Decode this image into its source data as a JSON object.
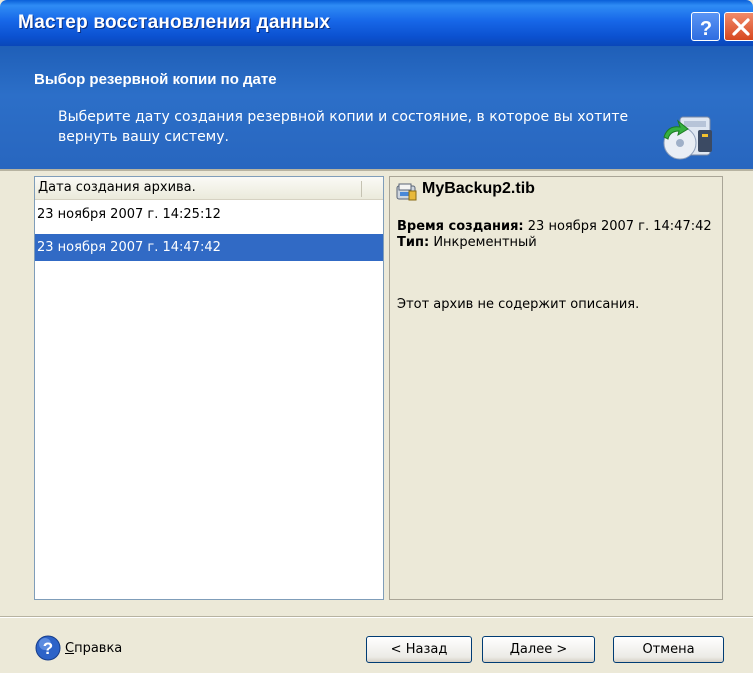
{
  "window": {
    "title": "Мастер восстановления данных",
    "help_button": "?",
    "close_button": "X"
  },
  "header": {
    "title": "Выбор резервной копии по дате",
    "description": "Выберите дату создания резервной копии и состояние, в которое вы хотите вернуть вашу систему."
  },
  "list": {
    "column_header": "Дата создания архива.",
    "rows": [
      {
        "label": "23 ноября 2007 г. 14:25:12",
        "selected": false
      },
      {
        "label": "23 ноября 2007 г. 14:47:42",
        "selected": true
      }
    ]
  },
  "details": {
    "file_name": "MyBackup2.tib",
    "created_label": "Время создания:",
    "created_value": "23 ноября 2007 г. 14:47:42",
    "type_label": "Тип:",
    "type_value": "Инкрементный",
    "description": "Этот архив не содержит описания."
  },
  "footer": {
    "help_label": "Справка",
    "help_underline": "С",
    "help_rest": "правка",
    "back_label": "< Назад",
    "next_label": "Далее >",
    "cancel_label": "Отмена"
  },
  "colors": {
    "titlebar": "#0b51d0",
    "header": "#2866bf",
    "selection": "#316ac5",
    "window_bg": "#ece9d8"
  }
}
